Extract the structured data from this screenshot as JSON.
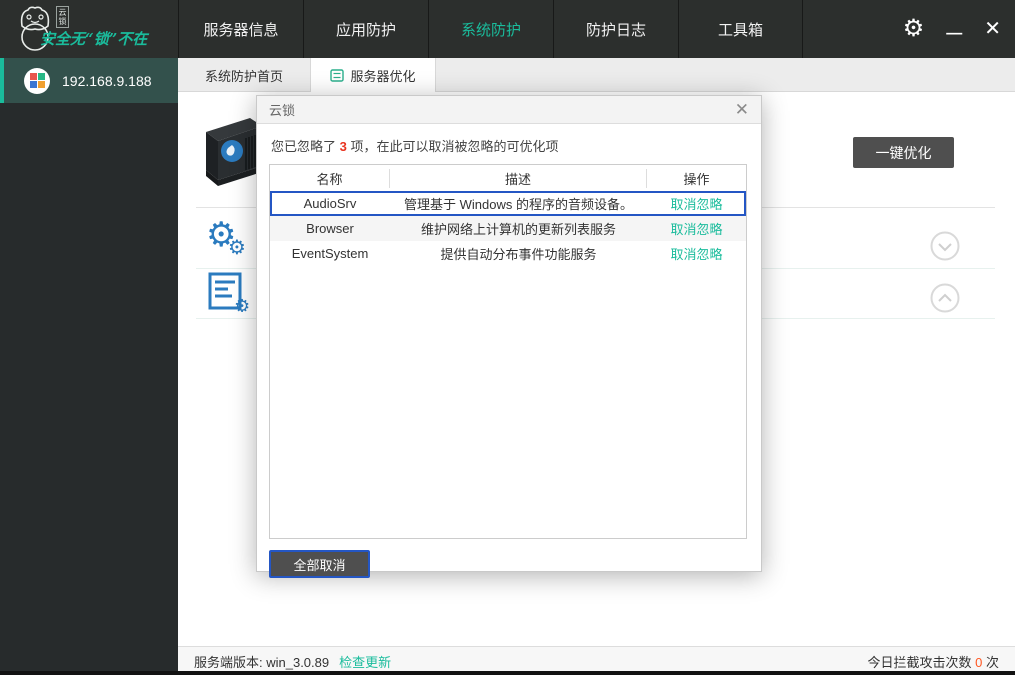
{
  "colors": {
    "accent_teal": "#1abc9c",
    "selection_blue": "#2456c4",
    "alert_red": "#e8321f",
    "count_orange": "#ff5722",
    "topbar_bg": "#2c2f2d",
    "icon_blue": "#2b7bbf"
  },
  "topbar": {
    "logo": {
      "stamp": "云锁",
      "slogan": "安全无“锁”不在"
    },
    "nav": [
      {
        "label": "服务器信息",
        "active": false
      },
      {
        "label": "应用防护",
        "active": false
      },
      {
        "label": "系统防护",
        "active": true
      },
      {
        "label": "防护日志",
        "active": false
      },
      {
        "label": "工具箱",
        "active": false
      }
    ],
    "controls": {
      "settings": "gear-icon",
      "minimize": "minimize-icon",
      "close": "close-icon"
    }
  },
  "sidebar": {
    "items": [
      {
        "label": "192.168.9.188",
        "active": true,
        "icon": "windows-logo-icon"
      }
    ]
  },
  "subtabs": [
    {
      "label": "系统防护首页",
      "active": false
    },
    {
      "label": "服务器优化",
      "active": true,
      "icon": "server-icon"
    }
  ],
  "main": {
    "optimize_button": "一键优化",
    "icons": [
      "server-image",
      "gears-icon",
      "service-list-icon",
      "chevron-down-icon",
      "chevron-up-icon"
    ]
  },
  "modal": {
    "title": "云锁",
    "close": "close-icon",
    "message": {
      "prefix": "您已忽略了 ",
      "count": "3",
      "suffix": " 项，在此可以取消被忽略的可优化项"
    },
    "table": {
      "headers": [
        "名称",
        "描述",
        "操作"
      ],
      "rows": [
        {
          "name": "AudioSrv",
          "desc": "管理基于 Windows 的程序的音频设备。",
          "action": "取消忽略",
          "selected": true
        },
        {
          "name": "Browser",
          "desc": "维护网络上计算机的更新列表服务",
          "action": "取消忽略",
          "selected": false
        },
        {
          "name": "EventSystem",
          "desc": "提供自动分布事件功能服务",
          "action": "取消忽略",
          "selected": false
        }
      ]
    },
    "cancel_all_button": "全部取消"
  },
  "statusbar": {
    "version_text": "服务端版本: win_3.0.89",
    "check_update": "检查更新",
    "attacks_label": "今日拦截攻击次数",
    "attacks_count": "0",
    "attacks_unit": "次"
  }
}
